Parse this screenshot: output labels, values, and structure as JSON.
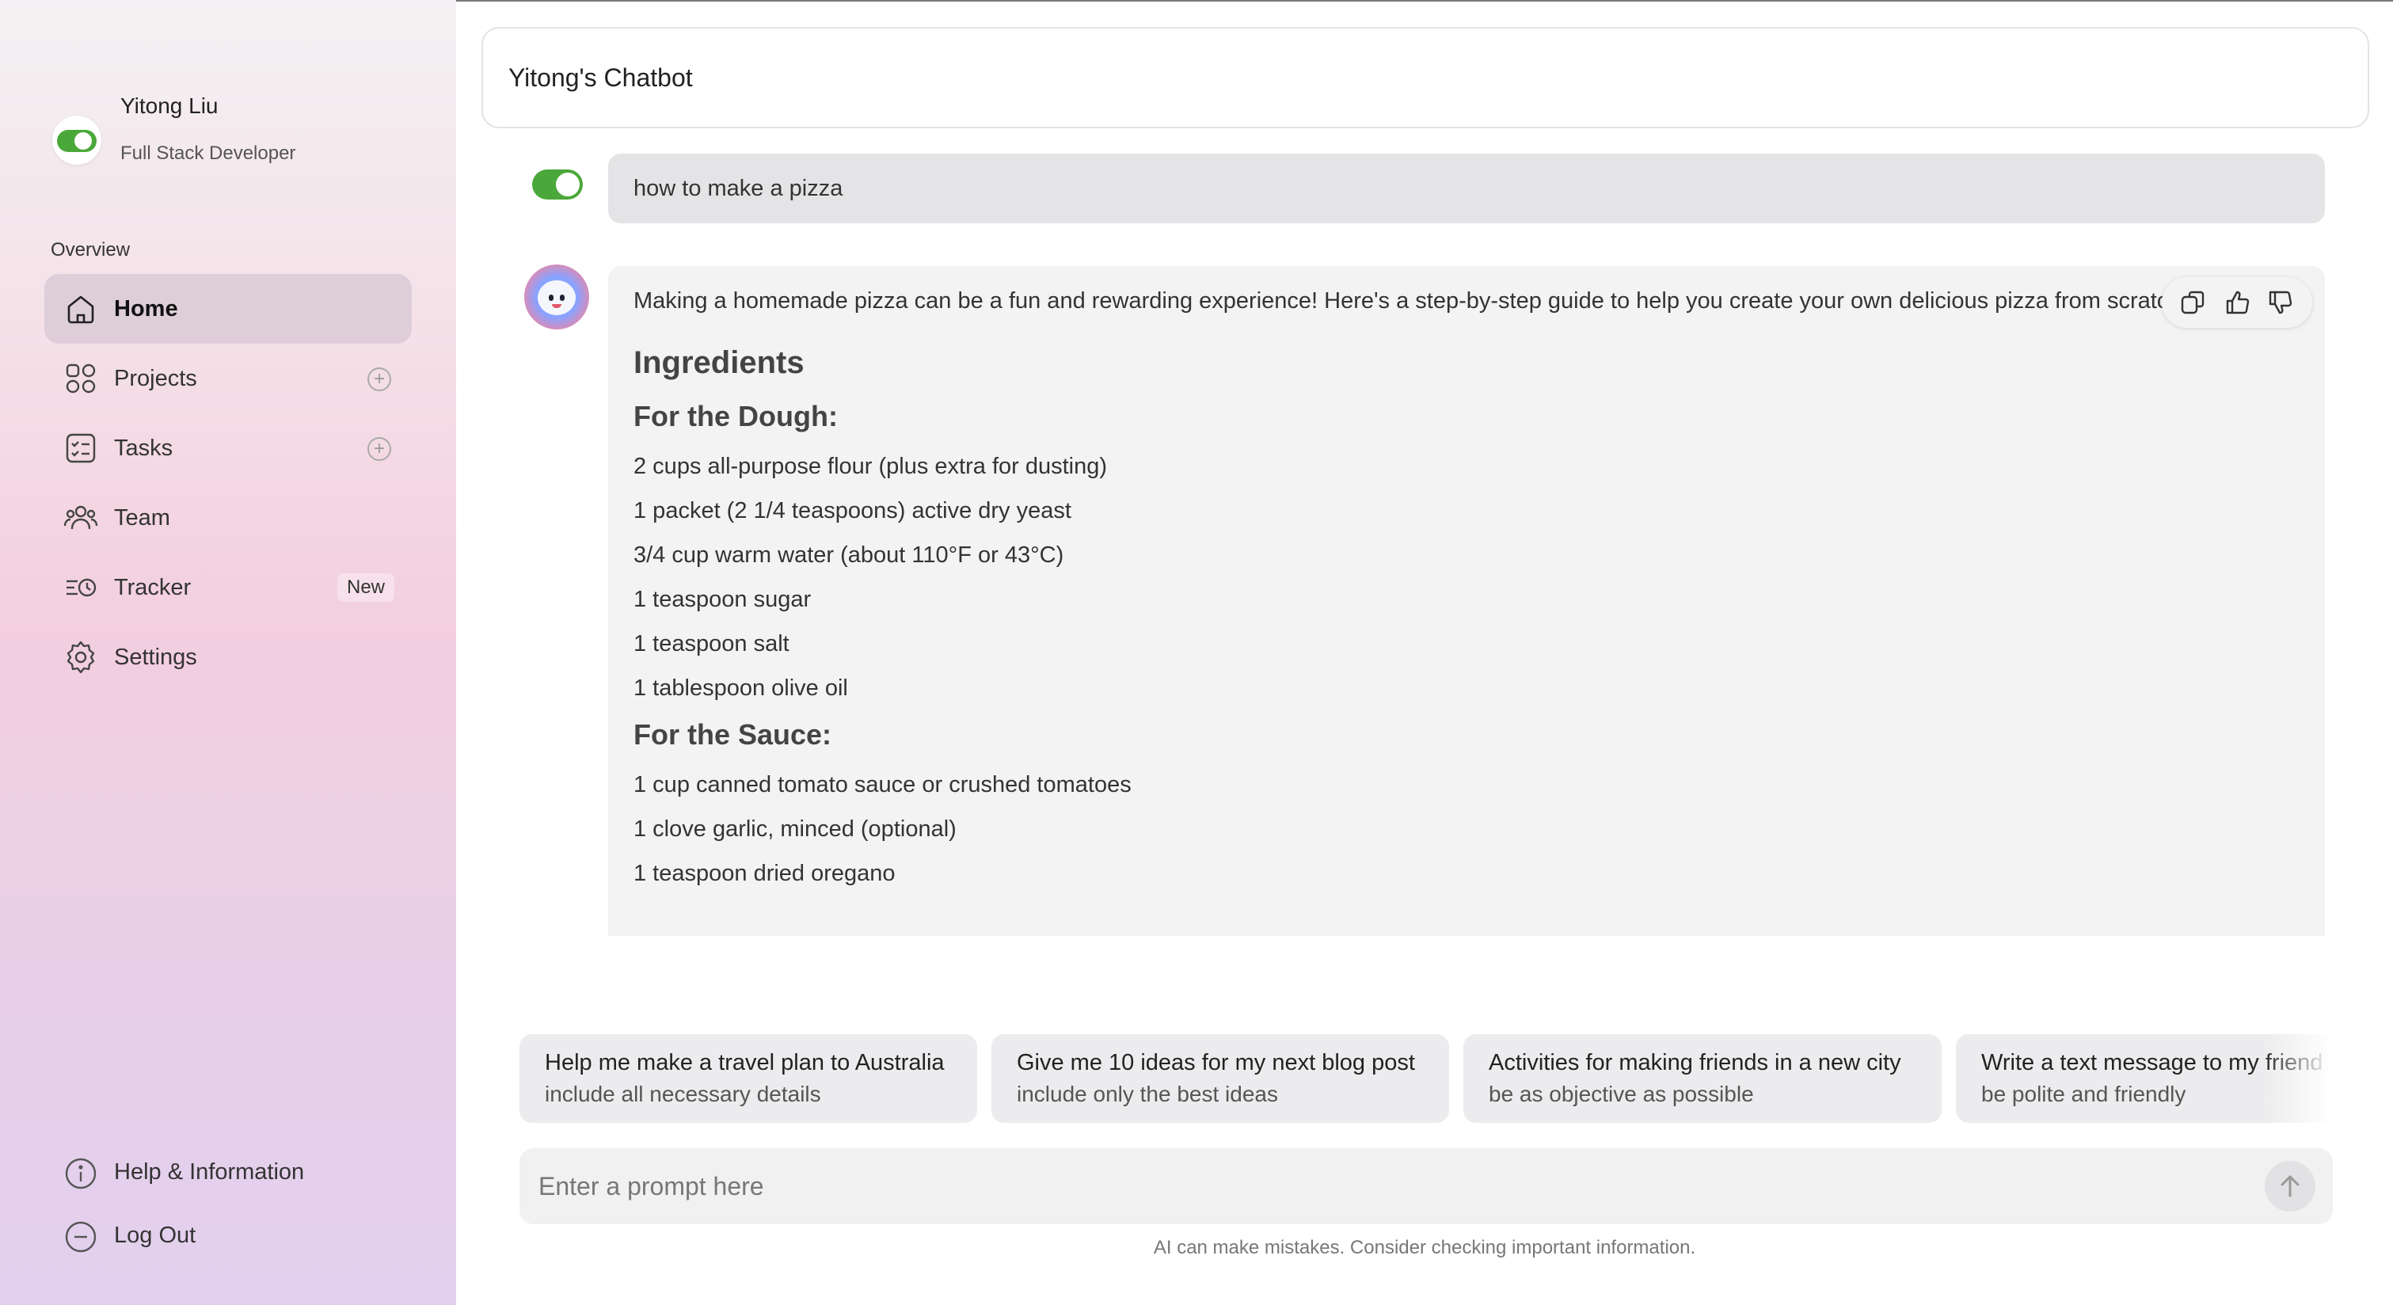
{
  "user": {
    "name": "Yitong Liu",
    "role": "Full Stack Developer"
  },
  "sidebar": {
    "section_label": "Overview",
    "items": [
      {
        "label": "Home",
        "icon": "home-icon",
        "active": true
      },
      {
        "label": "Projects",
        "icon": "grid-icon",
        "has_add": true
      },
      {
        "label": "Tasks",
        "icon": "checklist-icon",
        "has_add": true
      },
      {
        "label": "Team",
        "icon": "team-icon"
      },
      {
        "label": "Tracker",
        "icon": "tracker-icon",
        "badge": "New"
      },
      {
        "label": "Settings",
        "icon": "gear-icon"
      }
    ],
    "bottom": [
      {
        "label": "Help & Information",
        "icon": "info-icon"
      },
      {
        "label": "Log Out",
        "icon": "logout-icon"
      }
    ]
  },
  "header": {
    "title": "Yitong's Chatbot"
  },
  "chat": {
    "user_message": "how to make a pizza",
    "bot": {
      "intro": "Making a homemade pizza can be a fun and rewarding experience! Here's a step-by-step guide to help you create your own delicious pizza from scratch.",
      "heading": "Ingredients",
      "dough_heading": "For the Dough:",
      "dough": [
        "2 cups all-purpose flour (plus extra for dusting)",
        "1 packet (2 1/4 teaspoons) active dry yeast",
        "3/4 cup warm water (about 110°F or 43°C)",
        "1 teaspoon sugar",
        "1 teaspoon salt",
        "1 tablespoon olive oil"
      ],
      "sauce_heading": "For the Sauce:",
      "sauce": [
        "1 cup canned tomato sauce or crushed tomatoes",
        "1 clove garlic, minced (optional)",
        "1 teaspoon dried oregano"
      ]
    }
  },
  "suggestions": [
    {
      "title": "Help me make a travel plan to Australia",
      "subtitle": "include all necessary details"
    },
    {
      "title": "Give me 10 ideas for my next blog post",
      "subtitle": "include only the best ideas"
    },
    {
      "title": "Activities for making friends in a new city",
      "subtitle": "be as objective as possible"
    },
    {
      "title": "Write a text message to my friend",
      "subtitle": "be polite and friendly"
    }
  ],
  "prompt": {
    "placeholder": "Enter a prompt here",
    "value": ""
  },
  "disclaimer": "AI can make mistakes. Consider checking important information.",
  "colors": {
    "toggle_on": "#4aa83a",
    "bubble_user": "#e4e4e6",
    "bubble_bot": "#f3f3f4"
  }
}
